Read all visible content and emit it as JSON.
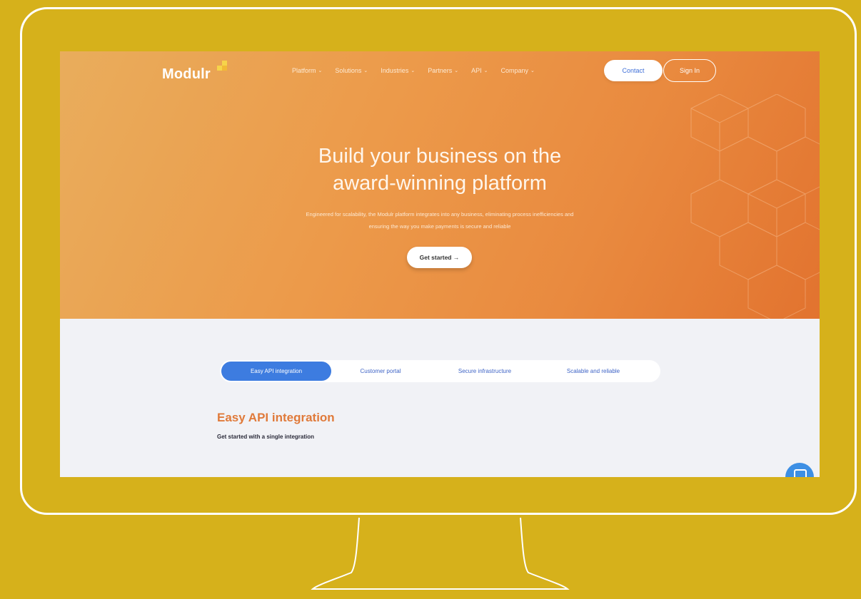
{
  "header": {
    "logo_text": "Modulr",
    "nav": [
      {
        "label": "Platform"
      },
      {
        "label": "Solutions"
      },
      {
        "label": "Industries"
      },
      {
        "label": "Partners"
      },
      {
        "label": "API"
      },
      {
        "label": "Company"
      }
    ],
    "contact_label": "Contact",
    "signin_label": "Sign In"
  },
  "hero": {
    "title_line1": "Build your business on the",
    "title_line2": "award-winning platform",
    "subtitle_line1": "Engineered for scalability, the Modulr platform integrates into any business, eliminating process inefficiencies and",
    "subtitle_line2": "ensuring the way you make payments is secure and reliable",
    "cta_label": "Get started →"
  },
  "features": {
    "tabs": [
      {
        "label": "Easy API integration"
      },
      {
        "label": "Customer portal"
      },
      {
        "label": "Secure infrastructure"
      },
      {
        "label": "Scalable and reliable"
      }
    ],
    "active_title": "Easy API integration",
    "active_subtitle": "Get started with a single integration"
  },
  "colors": {
    "background": "#d6b11b",
    "hero_orange": "#e98a3f",
    "accent_blue": "#3d7ce0",
    "section_title": "#e07a3a"
  },
  "icons": [
    "logo-mark-icon",
    "chevron-down-icon",
    "chat-icon"
  ]
}
